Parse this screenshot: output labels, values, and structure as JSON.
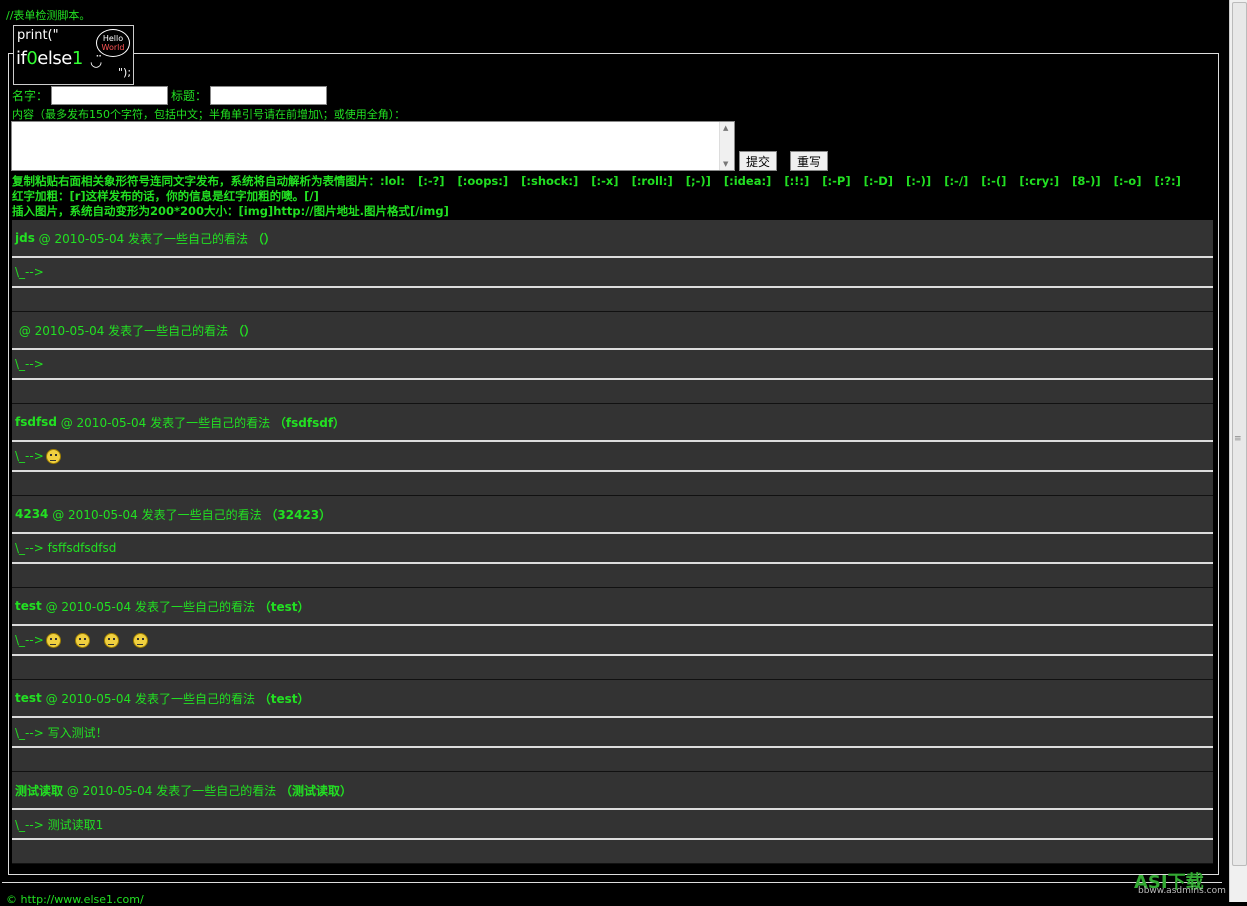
{
  "top_note": "//表单检测脚本。",
  "logo": {
    "line1": "print(\"",
    "line2_a": "if",
    "line2_b": "0",
    "line2_c": "else",
    "line2_d": "1",
    "line3": "\");",
    "bubble_a": "Hello",
    "bubble_b": "World"
  },
  "form": {
    "name_label": "名字：",
    "title_label": "标题：",
    "content_hint": "内容（最多发布150个字符，包括中文；半角单引号请在前增加\\；或使用全角）：",
    "submit_label": "提交",
    "reset_label": "重写"
  },
  "help": {
    "emoticon_prefix": "复制粘贴右面相关象形符号连同文字发布，系统将自动解析为表情图片：",
    "emoticons": [
      ":lol:",
      "[:-?]",
      "[:oops:]",
      "[:shock:]",
      "[:-x]",
      "[:roll:]",
      "[;-)]",
      "[:idea:]",
      "[:!:]",
      "[:-P]",
      "[:-D]",
      "[:-)]",
      "[:-/]",
      "[:-(]",
      "[:cry:]",
      "[8-)]",
      "[:-o]",
      "[:?:]"
    ],
    "red_text": "红字加粗：[r]这样发布的话，你的信息是红字加粗的噢。[/]",
    "image_text": "插入图片，系统自动变形为200*200大小：[img]http://图片地址.图片格式[/img]"
  },
  "entries": [
    {
      "name": "jds",
      "meta": " @ 2010-05-04 发表了一些自己的看法 ",
      "title": "（）",
      "body": "\\_-->",
      "smileys": 0
    },
    {
      "name": "",
      "meta": " @ 2010-05-04 发表了一些自己的看法 ",
      "title": "（）",
      "body": "\\_-->",
      "smileys": 0
    },
    {
      "name": "fsdfsd",
      "meta": " @ 2010-05-04 发表了一些自己的看法 ",
      "title": "（fsdfsdf）",
      "body": "\\_-->",
      "smileys": 1
    },
    {
      "name": "4234",
      "meta": " @ 2010-05-04 发表了一些自己的看法 ",
      "title": "（32423）",
      "body": "\\_--> fsffsdfsdfsd",
      "smileys": 0
    },
    {
      "name": "test",
      "meta": " @ 2010-05-04 发表了一些自己的看法 ",
      "title": "（test）",
      "body": "\\_-->",
      "smileys": 4
    },
    {
      "name": "test",
      "meta": " @ 2010-05-04 发表了一些自己的看法 ",
      "title": "（test）",
      "body": "\\_--> 写入测试！",
      "smileys": 0
    },
    {
      "name": "测试读取",
      "meta": " @ 2010-05-04 发表了一些自己的看法 ",
      "title": "（测试读取）",
      "body": "\\_--> 测试读取1",
      "smileys": 0
    }
  ],
  "footer_link": "© http://www.else1.com/",
  "watermark": {
    "main": "ASⅠ下载",
    "sub": "bbww.asdmins.com"
  }
}
